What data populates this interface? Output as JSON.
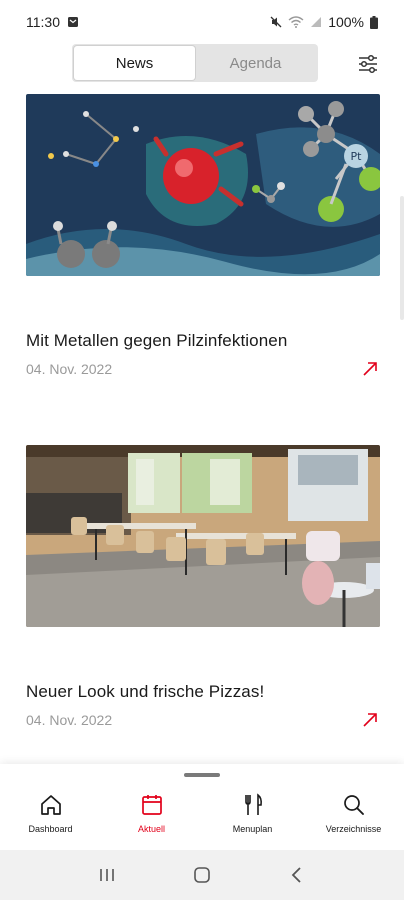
{
  "status": {
    "time": "11:30",
    "battery": "100%"
  },
  "tabs": [
    {
      "label": "News",
      "active": true
    },
    {
      "label": "Agenda",
      "active": false
    }
  ],
  "articles": [
    {
      "title": "Mit Metallen gegen Pilzinfektionen",
      "date": "04. Nov. 2022",
      "image": "molecules-illustration",
      "image_label": "Pt"
    },
    {
      "title": "Neuer Look und frische Pizzas!",
      "date": "04. Nov. 2022",
      "image": "cafeteria-photo"
    }
  ],
  "nav": [
    {
      "label": "Dashboard",
      "icon": "house-icon",
      "active": false
    },
    {
      "label": "Aktuell",
      "icon": "calendar-icon",
      "active": true
    },
    {
      "label": "Menuplan",
      "icon": "cutlery-icon",
      "active": false
    },
    {
      "label": "Verzeichnisse",
      "icon": "search-icon",
      "active": false
    }
  ],
  "colors": {
    "accent": "#e2001a",
    "segment_bg": "#e4e4e4",
    "date_text": "#9a9a9a"
  }
}
